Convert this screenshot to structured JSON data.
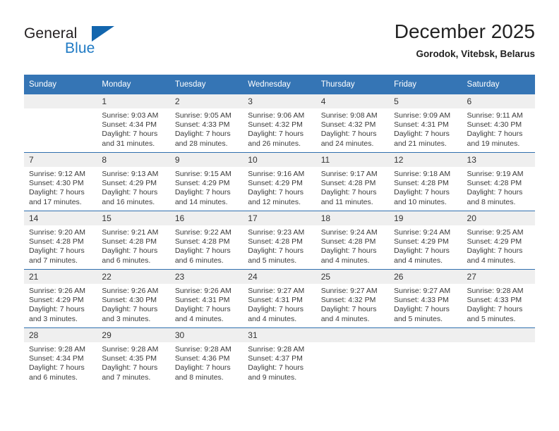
{
  "brand": {
    "name_part1": "General",
    "name_part2": "Blue",
    "triangle_color": "#1366ae",
    "blue_color": "#1f7ac4"
  },
  "header": {
    "title": "December 2025",
    "subtitle": "Gorodok, Vitebsk, Belarus"
  },
  "theme": {
    "header_row_bg": "#3575b5",
    "day_number_bg": "#efefef",
    "row_divider": "#2f6fae"
  },
  "weekdays": [
    "Sunday",
    "Monday",
    "Tuesday",
    "Wednesday",
    "Thursday",
    "Friday",
    "Saturday"
  ],
  "weeks": [
    [
      {
        "day": "",
        "sunrise": "",
        "sunset": "",
        "daylight1": "",
        "daylight2": ""
      },
      {
        "day": "1",
        "sunrise": "Sunrise: 9:03 AM",
        "sunset": "Sunset: 4:34 PM",
        "daylight1": "Daylight: 7 hours",
        "daylight2": "and 31 minutes."
      },
      {
        "day": "2",
        "sunrise": "Sunrise: 9:05 AM",
        "sunset": "Sunset: 4:33 PM",
        "daylight1": "Daylight: 7 hours",
        "daylight2": "and 28 minutes."
      },
      {
        "day": "3",
        "sunrise": "Sunrise: 9:06 AM",
        "sunset": "Sunset: 4:32 PM",
        "daylight1": "Daylight: 7 hours",
        "daylight2": "and 26 minutes."
      },
      {
        "day": "4",
        "sunrise": "Sunrise: 9:08 AM",
        "sunset": "Sunset: 4:32 PM",
        "daylight1": "Daylight: 7 hours",
        "daylight2": "and 24 minutes."
      },
      {
        "day": "5",
        "sunrise": "Sunrise: 9:09 AM",
        "sunset": "Sunset: 4:31 PM",
        "daylight1": "Daylight: 7 hours",
        "daylight2": "and 21 minutes."
      },
      {
        "day": "6",
        "sunrise": "Sunrise: 9:11 AM",
        "sunset": "Sunset: 4:30 PM",
        "daylight1": "Daylight: 7 hours",
        "daylight2": "and 19 minutes."
      }
    ],
    [
      {
        "day": "7",
        "sunrise": "Sunrise: 9:12 AM",
        "sunset": "Sunset: 4:30 PM",
        "daylight1": "Daylight: 7 hours",
        "daylight2": "and 17 minutes."
      },
      {
        "day": "8",
        "sunrise": "Sunrise: 9:13 AM",
        "sunset": "Sunset: 4:29 PM",
        "daylight1": "Daylight: 7 hours",
        "daylight2": "and 16 minutes."
      },
      {
        "day": "9",
        "sunrise": "Sunrise: 9:15 AM",
        "sunset": "Sunset: 4:29 PM",
        "daylight1": "Daylight: 7 hours",
        "daylight2": "and 14 minutes."
      },
      {
        "day": "10",
        "sunrise": "Sunrise: 9:16 AM",
        "sunset": "Sunset: 4:29 PM",
        "daylight1": "Daylight: 7 hours",
        "daylight2": "and 12 minutes."
      },
      {
        "day": "11",
        "sunrise": "Sunrise: 9:17 AM",
        "sunset": "Sunset: 4:28 PM",
        "daylight1": "Daylight: 7 hours",
        "daylight2": "and 11 minutes."
      },
      {
        "day": "12",
        "sunrise": "Sunrise: 9:18 AM",
        "sunset": "Sunset: 4:28 PM",
        "daylight1": "Daylight: 7 hours",
        "daylight2": "and 10 minutes."
      },
      {
        "day": "13",
        "sunrise": "Sunrise: 9:19 AM",
        "sunset": "Sunset: 4:28 PM",
        "daylight1": "Daylight: 7 hours",
        "daylight2": "and 8 minutes."
      }
    ],
    [
      {
        "day": "14",
        "sunrise": "Sunrise: 9:20 AM",
        "sunset": "Sunset: 4:28 PM",
        "daylight1": "Daylight: 7 hours",
        "daylight2": "and 7 minutes."
      },
      {
        "day": "15",
        "sunrise": "Sunrise: 9:21 AM",
        "sunset": "Sunset: 4:28 PM",
        "daylight1": "Daylight: 7 hours",
        "daylight2": "and 6 minutes."
      },
      {
        "day": "16",
        "sunrise": "Sunrise: 9:22 AM",
        "sunset": "Sunset: 4:28 PM",
        "daylight1": "Daylight: 7 hours",
        "daylight2": "and 6 minutes."
      },
      {
        "day": "17",
        "sunrise": "Sunrise: 9:23 AM",
        "sunset": "Sunset: 4:28 PM",
        "daylight1": "Daylight: 7 hours",
        "daylight2": "and 5 minutes."
      },
      {
        "day": "18",
        "sunrise": "Sunrise: 9:24 AM",
        "sunset": "Sunset: 4:28 PM",
        "daylight1": "Daylight: 7 hours",
        "daylight2": "and 4 minutes."
      },
      {
        "day": "19",
        "sunrise": "Sunrise: 9:24 AM",
        "sunset": "Sunset: 4:29 PM",
        "daylight1": "Daylight: 7 hours",
        "daylight2": "and 4 minutes."
      },
      {
        "day": "20",
        "sunrise": "Sunrise: 9:25 AM",
        "sunset": "Sunset: 4:29 PM",
        "daylight1": "Daylight: 7 hours",
        "daylight2": "and 4 minutes."
      }
    ],
    [
      {
        "day": "21",
        "sunrise": "Sunrise: 9:26 AM",
        "sunset": "Sunset: 4:29 PM",
        "daylight1": "Daylight: 7 hours",
        "daylight2": "and 3 minutes."
      },
      {
        "day": "22",
        "sunrise": "Sunrise: 9:26 AM",
        "sunset": "Sunset: 4:30 PM",
        "daylight1": "Daylight: 7 hours",
        "daylight2": "and 3 minutes."
      },
      {
        "day": "23",
        "sunrise": "Sunrise: 9:26 AM",
        "sunset": "Sunset: 4:31 PM",
        "daylight1": "Daylight: 7 hours",
        "daylight2": "and 4 minutes."
      },
      {
        "day": "24",
        "sunrise": "Sunrise: 9:27 AM",
        "sunset": "Sunset: 4:31 PM",
        "daylight1": "Daylight: 7 hours",
        "daylight2": "and 4 minutes."
      },
      {
        "day": "25",
        "sunrise": "Sunrise: 9:27 AM",
        "sunset": "Sunset: 4:32 PM",
        "daylight1": "Daylight: 7 hours",
        "daylight2": "and 4 minutes."
      },
      {
        "day": "26",
        "sunrise": "Sunrise: 9:27 AM",
        "sunset": "Sunset: 4:33 PM",
        "daylight1": "Daylight: 7 hours",
        "daylight2": "and 5 minutes."
      },
      {
        "day": "27",
        "sunrise": "Sunrise: 9:28 AM",
        "sunset": "Sunset: 4:33 PM",
        "daylight1": "Daylight: 7 hours",
        "daylight2": "and 5 minutes."
      }
    ],
    [
      {
        "day": "28",
        "sunrise": "Sunrise: 9:28 AM",
        "sunset": "Sunset: 4:34 PM",
        "daylight1": "Daylight: 7 hours",
        "daylight2": "and 6 minutes."
      },
      {
        "day": "29",
        "sunrise": "Sunrise: 9:28 AM",
        "sunset": "Sunset: 4:35 PM",
        "daylight1": "Daylight: 7 hours",
        "daylight2": "and 7 minutes."
      },
      {
        "day": "30",
        "sunrise": "Sunrise: 9:28 AM",
        "sunset": "Sunset: 4:36 PM",
        "daylight1": "Daylight: 7 hours",
        "daylight2": "and 8 minutes."
      },
      {
        "day": "31",
        "sunrise": "Sunrise: 9:28 AM",
        "sunset": "Sunset: 4:37 PM",
        "daylight1": "Daylight: 7 hours",
        "daylight2": "and 9 minutes."
      },
      {
        "day": "",
        "sunrise": "",
        "sunset": "",
        "daylight1": "",
        "daylight2": ""
      },
      {
        "day": "",
        "sunrise": "",
        "sunset": "",
        "daylight1": "",
        "daylight2": ""
      },
      {
        "day": "",
        "sunrise": "",
        "sunset": "",
        "daylight1": "",
        "daylight2": ""
      }
    ]
  ]
}
